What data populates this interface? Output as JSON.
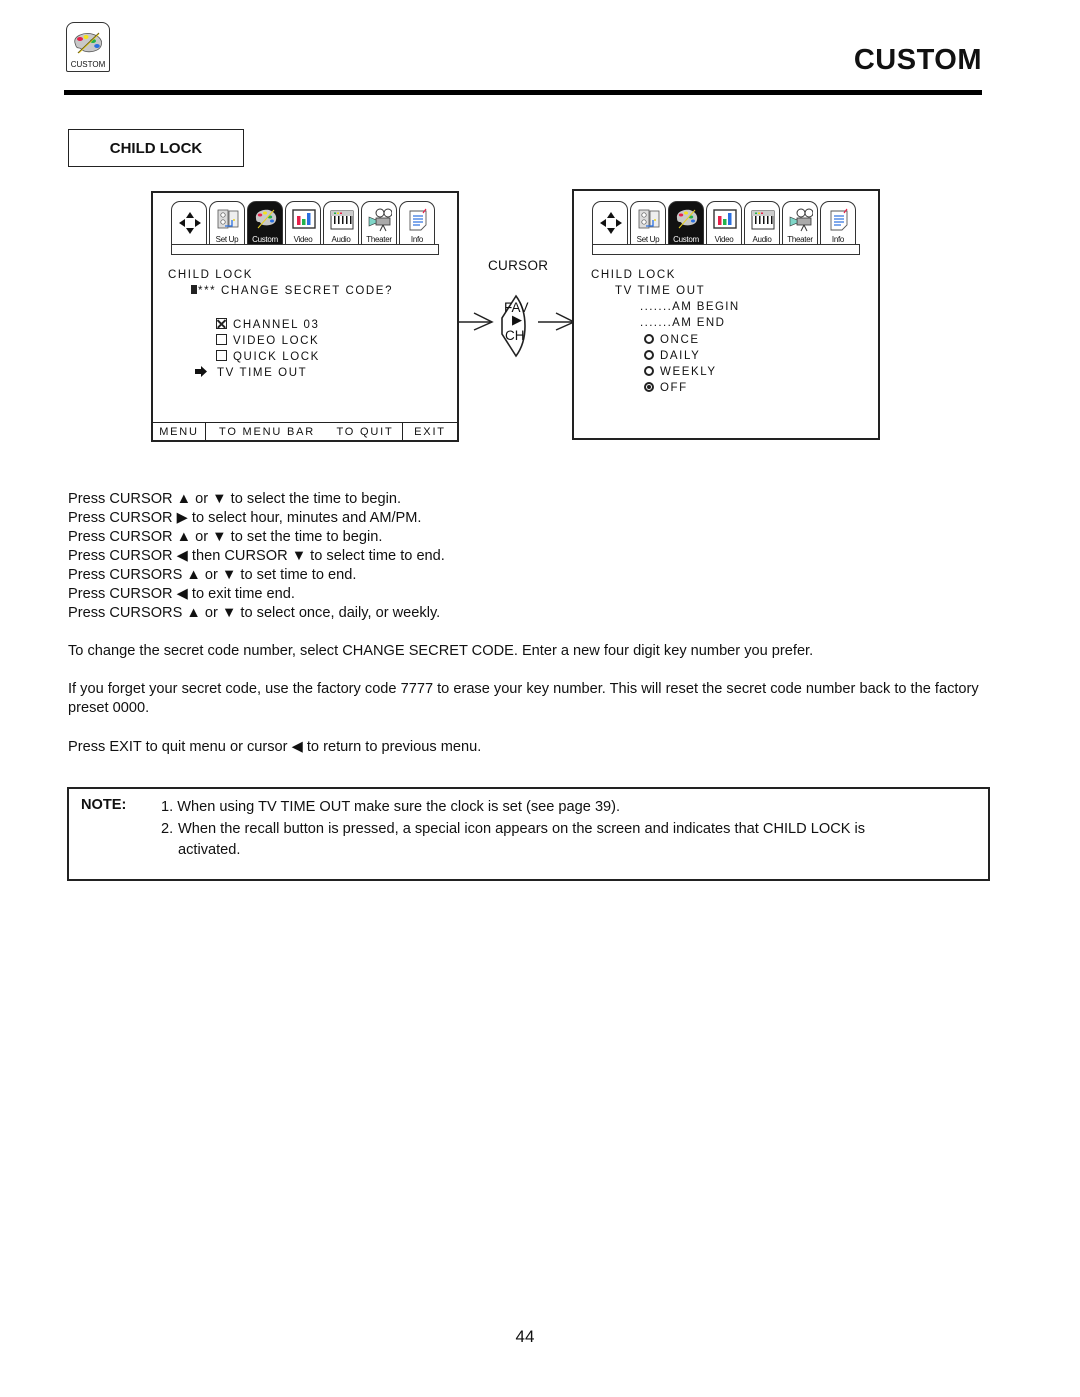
{
  "header": {
    "logo_caption": "CUSTOM",
    "page_title": "CUSTOM"
  },
  "section": {
    "title": "CHILD LOCK"
  },
  "menu_tabs": [
    {
      "label": "",
      "icon": "direction-arrows-icon"
    },
    {
      "label": "Set Up",
      "icon": "setup-panel-icon"
    },
    {
      "label": "Custom",
      "icon": "palette-icon",
      "active": true
    },
    {
      "label": "Video",
      "icon": "bar-chart-tv-icon"
    },
    {
      "label": "Audio",
      "icon": "keyboard-icon"
    },
    {
      "label": "Theater",
      "icon": "film-projector-icon"
    },
    {
      "label": "Info",
      "icon": "notepad-icon"
    }
  ],
  "screen_left": {
    "heading": "CHILD LOCK",
    "change_code": "*** CHANGE SECRET CODE?",
    "items": [
      {
        "label": "CHANNEL 03",
        "control": "checkbox",
        "checked": true
      },
      {
        "label": "VIDEO LOCK",
        "control": "checkbox",
        "checked": false
      },
      {
        "label": "QUICK LOCK",
        "control": "checkbox",
        "checked": false
      },
      {
        "label": "TV TIME OUT",
        "control": "arrow-pointer",
        "selected": true
      }
    ],
    "bottom_bar": {
      "menu": "MENU",
      "to_menu_bar": "TO MENU BAR",
      "to_quit": "TO QUIT",
      "exit": "EXIT"
    }
  },
  "cursor_control": {
    "label": "CURSOR",
    "fav": "FAV",
    "ch": "CH",
    "arrow": "▶"
  },
  "screen_right": {
    "heading": "CHILD LOCK",
    "subheading": "TV TIME OUT",
    "begin": ".......AM BEGIN",
    "end": ".......AM END",
    "options": [
      {
        "label": "ONCE",
        "selected": false
      },
      {
        "label": "DAILY",
        "selected": false
      },
      {
        "label": "WEEKLY",
        "selected": false
      },
      {
        "label": "OFF",
        "selected": true
      }
    ]
  },
  "instructions": [
    "Press CURSOR ▲ or ▼ to select the time to begin.",
    "Press CURSOR ▶ to select hour, minutes and AM/PM.",
    "Press CURSOR ▲ or ▼ to set the time to begin.",
    "Press CURSOR ◀ then CURSOR ▼ to select time to end.",
    "Press CURSORS ▲ or ▼ to set time to end.",
    "Press CURSOR ◀ to exit time end.",
    "Press CURSORS ▲ or ▼ to select once, daily, or weekly."
  ],
  "paragraphs": [
    "To change the secret code number, select CHANGE SECRET CODE.  Enter a new four digit key number you prefer.",
    "If you forget your secret code, use the factory code 7777 to erase your key number. This will reset the secret code number back to the factory preset 0000.",
    "Press EXIT to quit menu or cursor ◀  to return to previous menu."
  ],
  "note": {
    "label": "NOTE:",
    "item1": "1. When using TV TIME OUT make sure the clock is set (see page 39).",
    "item2_num": "2.",
    "item2_line1": "When the recall button is pressed, a special icon appears on the screen and indicates that CHILD LOCK is",
    "item2_line2": "activated."
  },
  "footer": {
    "page_number": "44"
  }
}
